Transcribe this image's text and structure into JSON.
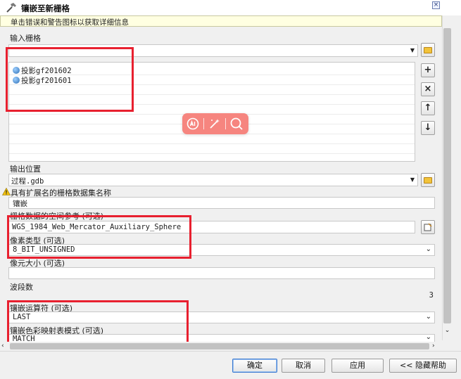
{
  "window": {
    "title": "镶嵌至新栅格"
  },
  "hint": {
    "text": "单击错误和警告图标以获取详细信息",
    "close_glyph": "×"
  },
  "input_rasters": {
    "label": "输入栅格",
    "value": "",
    "items": [
      "投影gf201602",
      "投影gf201601"
    ],
    "buttons": {
      "add": "+",
      "remove": "×",
      "up": "↑",
      "down": "↓"
    }
  },
  "output_location": {
    "label": "输出位置",
    "value": "过程.gdb"
  },
  "dataset_name": {
    "label": "具有扩展名的栅格数据集名称",
    "value": "镶嵌",
    "warning_icon": "warning-icon"
  },
  "spatial_reference": {
    "label": "栅格数据的空间参考 (可选)",
    "value": "WGS_1984_Web_Mercator_Auxiliary_Sphere"
  },
  "pixel_type": {
    "label": "像素类型 (可选)",
    "value": "8_BIT_UNSIGNED"
  },
  "cell_size": {
    "label": "像元大小 (可选)",
    "value": ""
  },
  "band_count": {
    "label": "波段数",
    "value": "3"
  },
  "mosaic_operator": {
    "label": "镶嵌运算符 (可选)",
    "value": "LAST"
  },
  "colormap_mode": {
    "label": "镶嵌色彩映射表模式 (可选)",
    "value": "MATCH"
  },
  "footer": {
    "ok": "确定",
    "cancel": "取消",
    "apply": "应用",
    "hide_help": "<< 隐藏帮助"
  },
  "colors": {
    "highlight": "#e8202f",
    "ai_toolbar": "#f6857f",
    "hint_bg": "#ffffe1"
  }
}
